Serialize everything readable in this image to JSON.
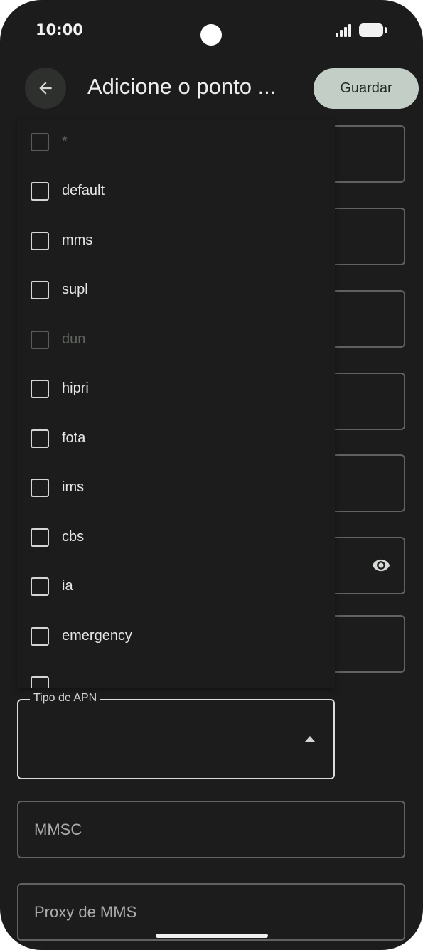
{
  "status_bar": {
    "time": "10:00"
  },
  "header": {
    "title": "Adicione o ponto ...",
    "save_label": "Guardar"
  },
  "apn_type_menu": {
    "items": [
      {
        "label": "*",
        "enabled": false
      },
      {
        "label": "default",
        "enabled": true
      },
      {
        "label": "mms",
        "enabled": true
      },
      {
        "label": "supl",
        "enabled": true
      },
      {
        "label": "dun",
        "enabled": false
      },
      {
        "label": "hipri",
        "enabled": true
      },
      {
        "label": "fota",
        "enabled": true
      },
      {
        "label": "ims",
        "enabled": true
      },
      {
        "label": "cbs",
        "enabled": true
      },
      {
        "label": "ia",
        "enabled": true
      },
      {
        "label": "emergency",
        "enabled": true
      }
    ]
  },
  "fields": {
    "apn_type_label": "Tipo de APN",
    "apn_type_value": "",
    "mmsc_placeholder": "MMSC",
    "mms_proxy_placeholder": "Proxy de MMS"
  }
}
